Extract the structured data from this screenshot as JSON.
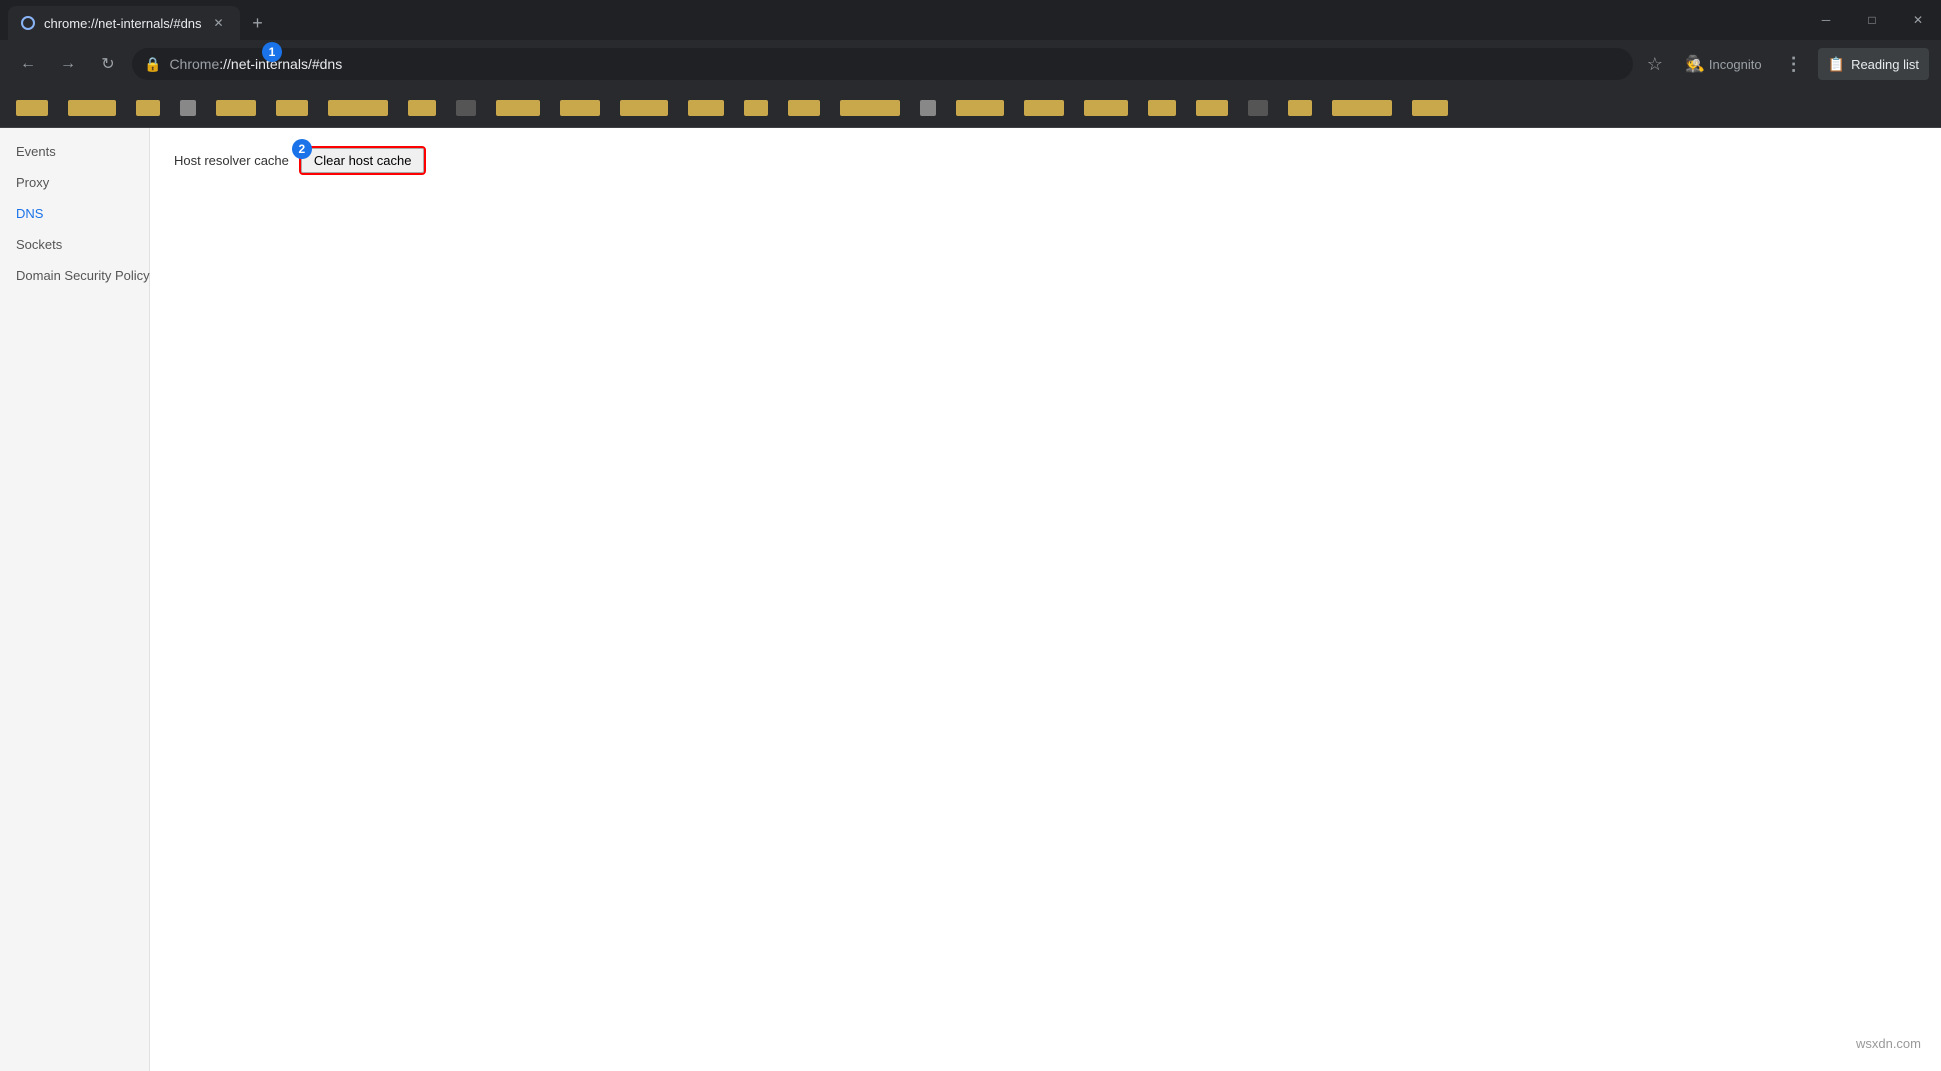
{
  "browser": {
    "tab": {
      "title": "chrome://net-internals/#dns",
      "favicon_label": "chrome-favicon"
    },
    "new_tab_label": "+",
    "window_controls": {
      "minimize": "─",
      "maximize": "□",
      "close": "✕"
    }
  },
  "navbar": {
    "back_label": "←",
    "forward_label": "→",
    "reload_label": "↻",
    "address": "chrome://net-internals/#dns",
    "address_prefix": "Chrome",
    "address_highlighted": "hrome://net-internals/#dns",
    "star_label": "☆",
    "incognito_label": "Incognito",
    "menu_label": "⋮",
    "reading_list_label": "Reading list"
  },
  "sidebar": {
    "items": [
      {
        "id": "events",
        "label": "Events",
        "active": false
      },
      {
        "id": "proxy",
        "label": "Proxy",
        "active": false
      },
      {
        "id": "dns",
        "label": "DNS",
        "active": true
      },
      {
        "id": "sockets",
        "label": "Sockets",
        "active": false
      },
      {
        "id": "domain-security-policy",
        "label": "Domain Security Policy",
        "active": false
      }
    ]
  },
  "content": {
    "host_resolver_label": "Host resolver cache",
    "clear_cache_button_label": "Clear host cache"
  },
  "annotations": {
    "badge1_number": "1",
    "badge2_number": "2"
  },
  "watermark": {
    "text": "wsxdn.com"
  },
  "bookmarks": [
    {
      "id": "bm1",
      "class": "bm1"
    },
    {
      "id": "bm2",
      "class": "bm2"
    },
    {
      "id": "bm3",
      "class": "bm3"
    },
    {
      "id": "bm4",
      "class": "bm4"
    },
    {
      "id": "bm5",
      "class": "bm5"
    },
    {
      "id": "bm6",
      "class": "bm6"
    },
    {
      "id": "bm7",
      "class": "bm7"
    },
    {
      "id": "bm8",
      "class": "bm8"
    },
    {
      "id": "bm9",
      "class": "bm9"
    },
    {
      "id": "bm10",
      "class": "bm10"
    }
  ]
}
